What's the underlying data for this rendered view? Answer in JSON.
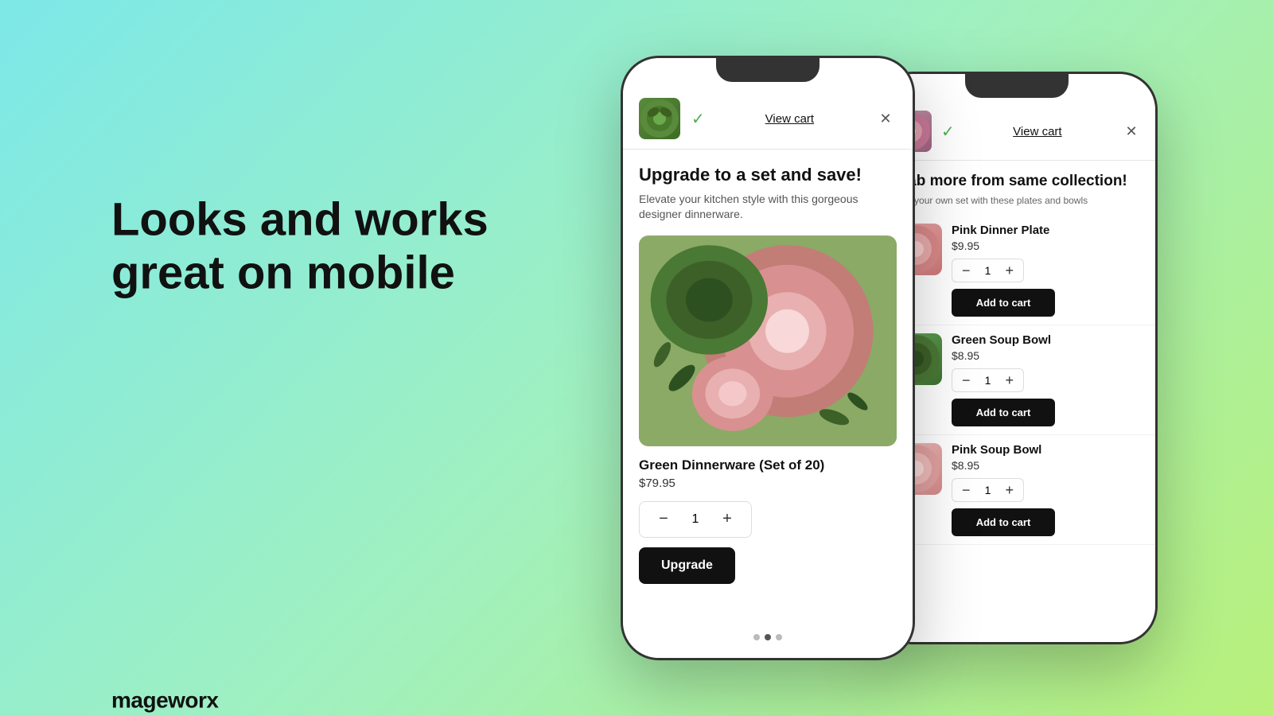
{
  "background": {
    "gradient_start": "#7de8e8",
    "gradient_end": "#b8f07a"
  },
  "hero": {
    "title": "Looks and works great on mobile",
    "brand": "mageworx"
  },
  "phone1": {
    "header": {
      "view_cart_label": "View cart",
      "close_symbol": "✕"
    },
    "cart_popup": {
      "title": "Upgrade to a set and save!",
      "subtitle": "Elevate your kitchen style with this gorgeous designer dinnerware.",
      "product_name": "Green Dinnerware (Set of 20)",
      "product_price": "$79.95",
      "quantity": 1,
      "upgrade_button": "Upgrade"
    },
    "dots": [
      {
        "active": false
      },
      {
        "active": true
      },
      {
        "active": false
      }
    ]
  },
  "phone2": {
    "header": {
      "view_cart_label": "View cart",
      "close_symbol": "✕"
    },
    "cart_popup": {
      "title": "Grab more from same collection!",
      "subtitle": "Build your own set with these plates and bowls",
      "products": [
        {
          "name": "Pink Dinner Plate",
          "price": "$9.95",
          "quantity": 1,
          "add_to_cart_label": "Add to cart"
        },
        {
          "name": "Green Soup Bowl",
          "price": "$8.95",
          "quantity": 1,
          "add_to_cart_label": "Add to cart"
        },
        {
          "name": "Pink Soup Bowl",
          "price": "$8.95",
          "quantity": 1,
          "add_to_cart_label": "Add to cart"
        }
      ]
    }
  }
}
